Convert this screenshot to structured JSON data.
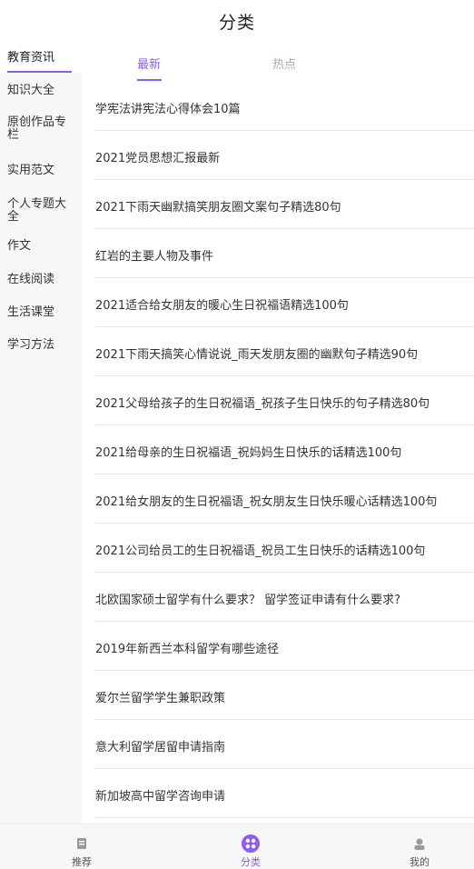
{
  "header": {
    "title": "分类"
  },
  "sidebar": {
    "items": [
      {
        "label": "教育资讯"
      },
      {
        "label": "知识大全"
      },
      {
        "label": "原创作品专栏"
      },
      {
        "label": "实用范文"
      },
      {
        "label": "个人专题大全"
      },
      {
        "label": "作文"
      },
      {
        "label": "在线阅读"
      },
      {
        "label": "生活课堂"
      },
      {
        "label": "学习方法"
      }
    ],
    "active_index": 0
  },
  "tabs": [
    {
      "label": "最新"
    },
    {
      "label": "热点"
    }
  ],
  "articles": [
    "学宪法讲宪法心得体会10篇",
    "2021党员思想汇报最新",
    "2021下雨天幽默搞笑朋友圈文案句子精选80句",
    "红岩的主要人物及事件",
    "2021适合给女朋友的暖心生日祝福语精选100句",
    "2021下雨天搞笑心情说说_雨天发朋友圈的幽默句子精选90句",
    "2021父母给孩子的生日祝福语_祝孩子生日快乐的句子精选80句",
    "2021给母亲的生日祝福语_祝妈妈生日快乐的话精选100句",
    "2021给女朋友的生日祝福语_祝女朋友生日快乐暖心话精选100句",
    "2021公司给员工的生日祝福语_祝员工生日快乐的话精选100句",
    "北欧国家硕士留学有什么要求？ 留学签证申请有什么要求?",
    "2019年新西兰本科留学有哪些途径",
    "爱尔兰留学学生兼职政策",
    "意大利留学居留申请指南",
    "新加坡高中留学咨询申请"
  ],
  "tabbar": {
    "items": [
      {
        "label": "推荐",
        "icon": "recommend-icon"
      },
      {
        "label": "分类",
        "icon": "category-icon"
      },
      {
        "label": "我的",
        "icon": "profile-icon"
      }
    ]
  },
  "colors": {
    "accent": "#8b5cf6",
    "sidebar_bg": "#f7f7f7",
    "separator": "#e6e6e6"
  }
}
